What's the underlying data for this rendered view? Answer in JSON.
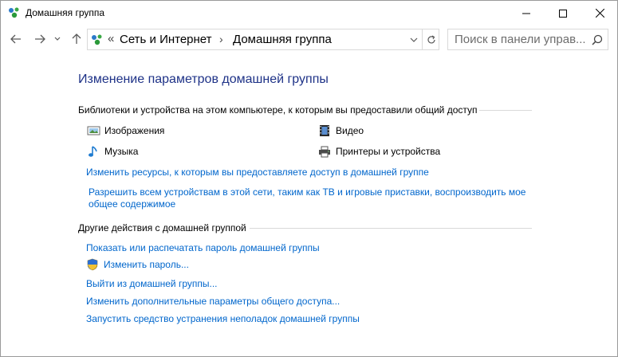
{
  "window": {
    "title": "Домашняя группа"
  },
  "address": {
    "crumbs": [
      "Сеть и Интернет",
      "Домашняя группа"
    ],
    "chevron": "«",
    "separator": "›"
  },
  "search": {
    "placeholder": "Поиск в панели управ..."
  },
  "page": {
    "title": "Изменение параметров домашней группы",
    "libraries": {
      "heading": "Библиотеки и устройства на этом компьютере, к которым вы предоставили общий доступ",
      "items": [
        {
          "label": "Изображения",
          "icon": "pictures-icon"
        },
        {
          "label": "Видео",
          "icon": "video-icon"
        },
        {
          "label": "Музыка",
          "icon": "music-icon"
        },
        {
          "label": "Принтеры и устройства",
          "icon": "printer-icon"
        }
      ],
      "change_link": "Изменить ресурсы, к которым вы предоставляете доступ в домашней группе",
      "allow_link": "Разрешить всем устройствам в этой сети, таким как ТВ и игровые приставки, воспроизводить мое общее содержимое"
    },
    "other": {
      "heading": "Другие действия с домашней группой",
      "links": [
        "Показать или распечатать пароль домашней группы",
        "Изменить пароль...",
        "Выйти из домашней группы...",
        "Изменить дополнительные параметры общего доступа...",
        "Запустить средство устранения неполадок домашней группы"
      ]
    }
  },
  "colors": {
    "link": "#0066cc",
    "title": "#1e3287",
    "divider": "#d9d9d9"
  }
}
